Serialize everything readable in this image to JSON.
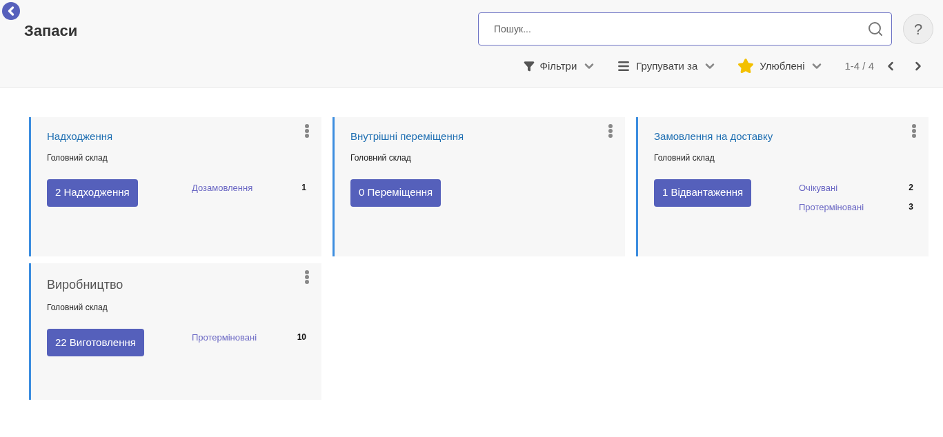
{
  "header": {
    "title": "Запаси",
    "search": {
      "placeholder": "Пошук..."
    },
    "help": "?",
    "toolbar": [
      {
        "kind": "filter",
        "label": "Фільтри"
      },
      {
        "kind": "group",
        "label": "Групувати за"
      },
      {
        "kind": "favorite",
        "label": "Улюблені"
      }
    ],
    "pager": "1-4 / 4"
  },
  "cards": [
    {
      "kind": "link",
      "title": "Надходження",
      "subtitle": "Головний склад",
      "button": "2 Надходження",
      "stats": [
        {
          "label": "Дозамовлення",
          "count": "1"
        }
      ]
    },
    {
      "kind": "link",
      "title": "Внутрішні переміщення",
      "subtitle": "Головний склад",
      "button": "0 Переміщення"
    },
    {
      "kind": "link",
      "title": "Замовлення на доставку",
      "subtitle": "Головний склад",
      "button": "1 Відвантаження",
      "stats": [
        {
          "label": "Очікувані",
          "count": "2"
        },
        {
          "label": "Протерміновані",
          "count": "3"
        }
      ]
    },
    {
      "kind": "plain",
      "title": "Виробництво",
      "subtitle": "Головний склад",
      "button": "22 Виготовлення",
      "stats": [
        {
          "label": "Протерміновані",
          "count": "10"
        }
      ]
    }
  ]
}
